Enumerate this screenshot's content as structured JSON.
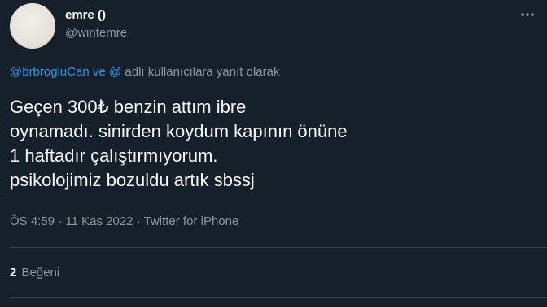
{
  "user": {
    "display_name": "emre ()",
    "handle": "@wintemre"
  },
  "reply_to": {
    "mention_1": "@brbrogluCan",
    "joiner": "ve",
    "mention_2": "@",
    "suffix": "adlı kullanıcılara yanıt olarak"
  },
  "tweet": {
    "lines": [
      "Geçen 300₺ benzin attım ibre",
      "oynamadı. sinirden koydum kapının önüne",
      "1 haftadır çalıştırmıyorum.",
      "psikolojimiz bozuldu artık sbssj"
    ]
  },
  "meta": {
    "time": "ÖS 4:59",
    "separator": "·",
    "date": "11 Kas 2022",
    "source": "Twitter for iPhone"
  },
  "stats": {
    "likes_count": "2",
    "likes_label": "Beğeni"
  },
  "colors": {
    "background": "#15202b",
    "accent": "#1d9bf0",
    "secondary_text": "#8b98a5",
    "divider": "#38444d"
  },
  "icons": {
    "more": "more-horizontal-icon"
  }
}
